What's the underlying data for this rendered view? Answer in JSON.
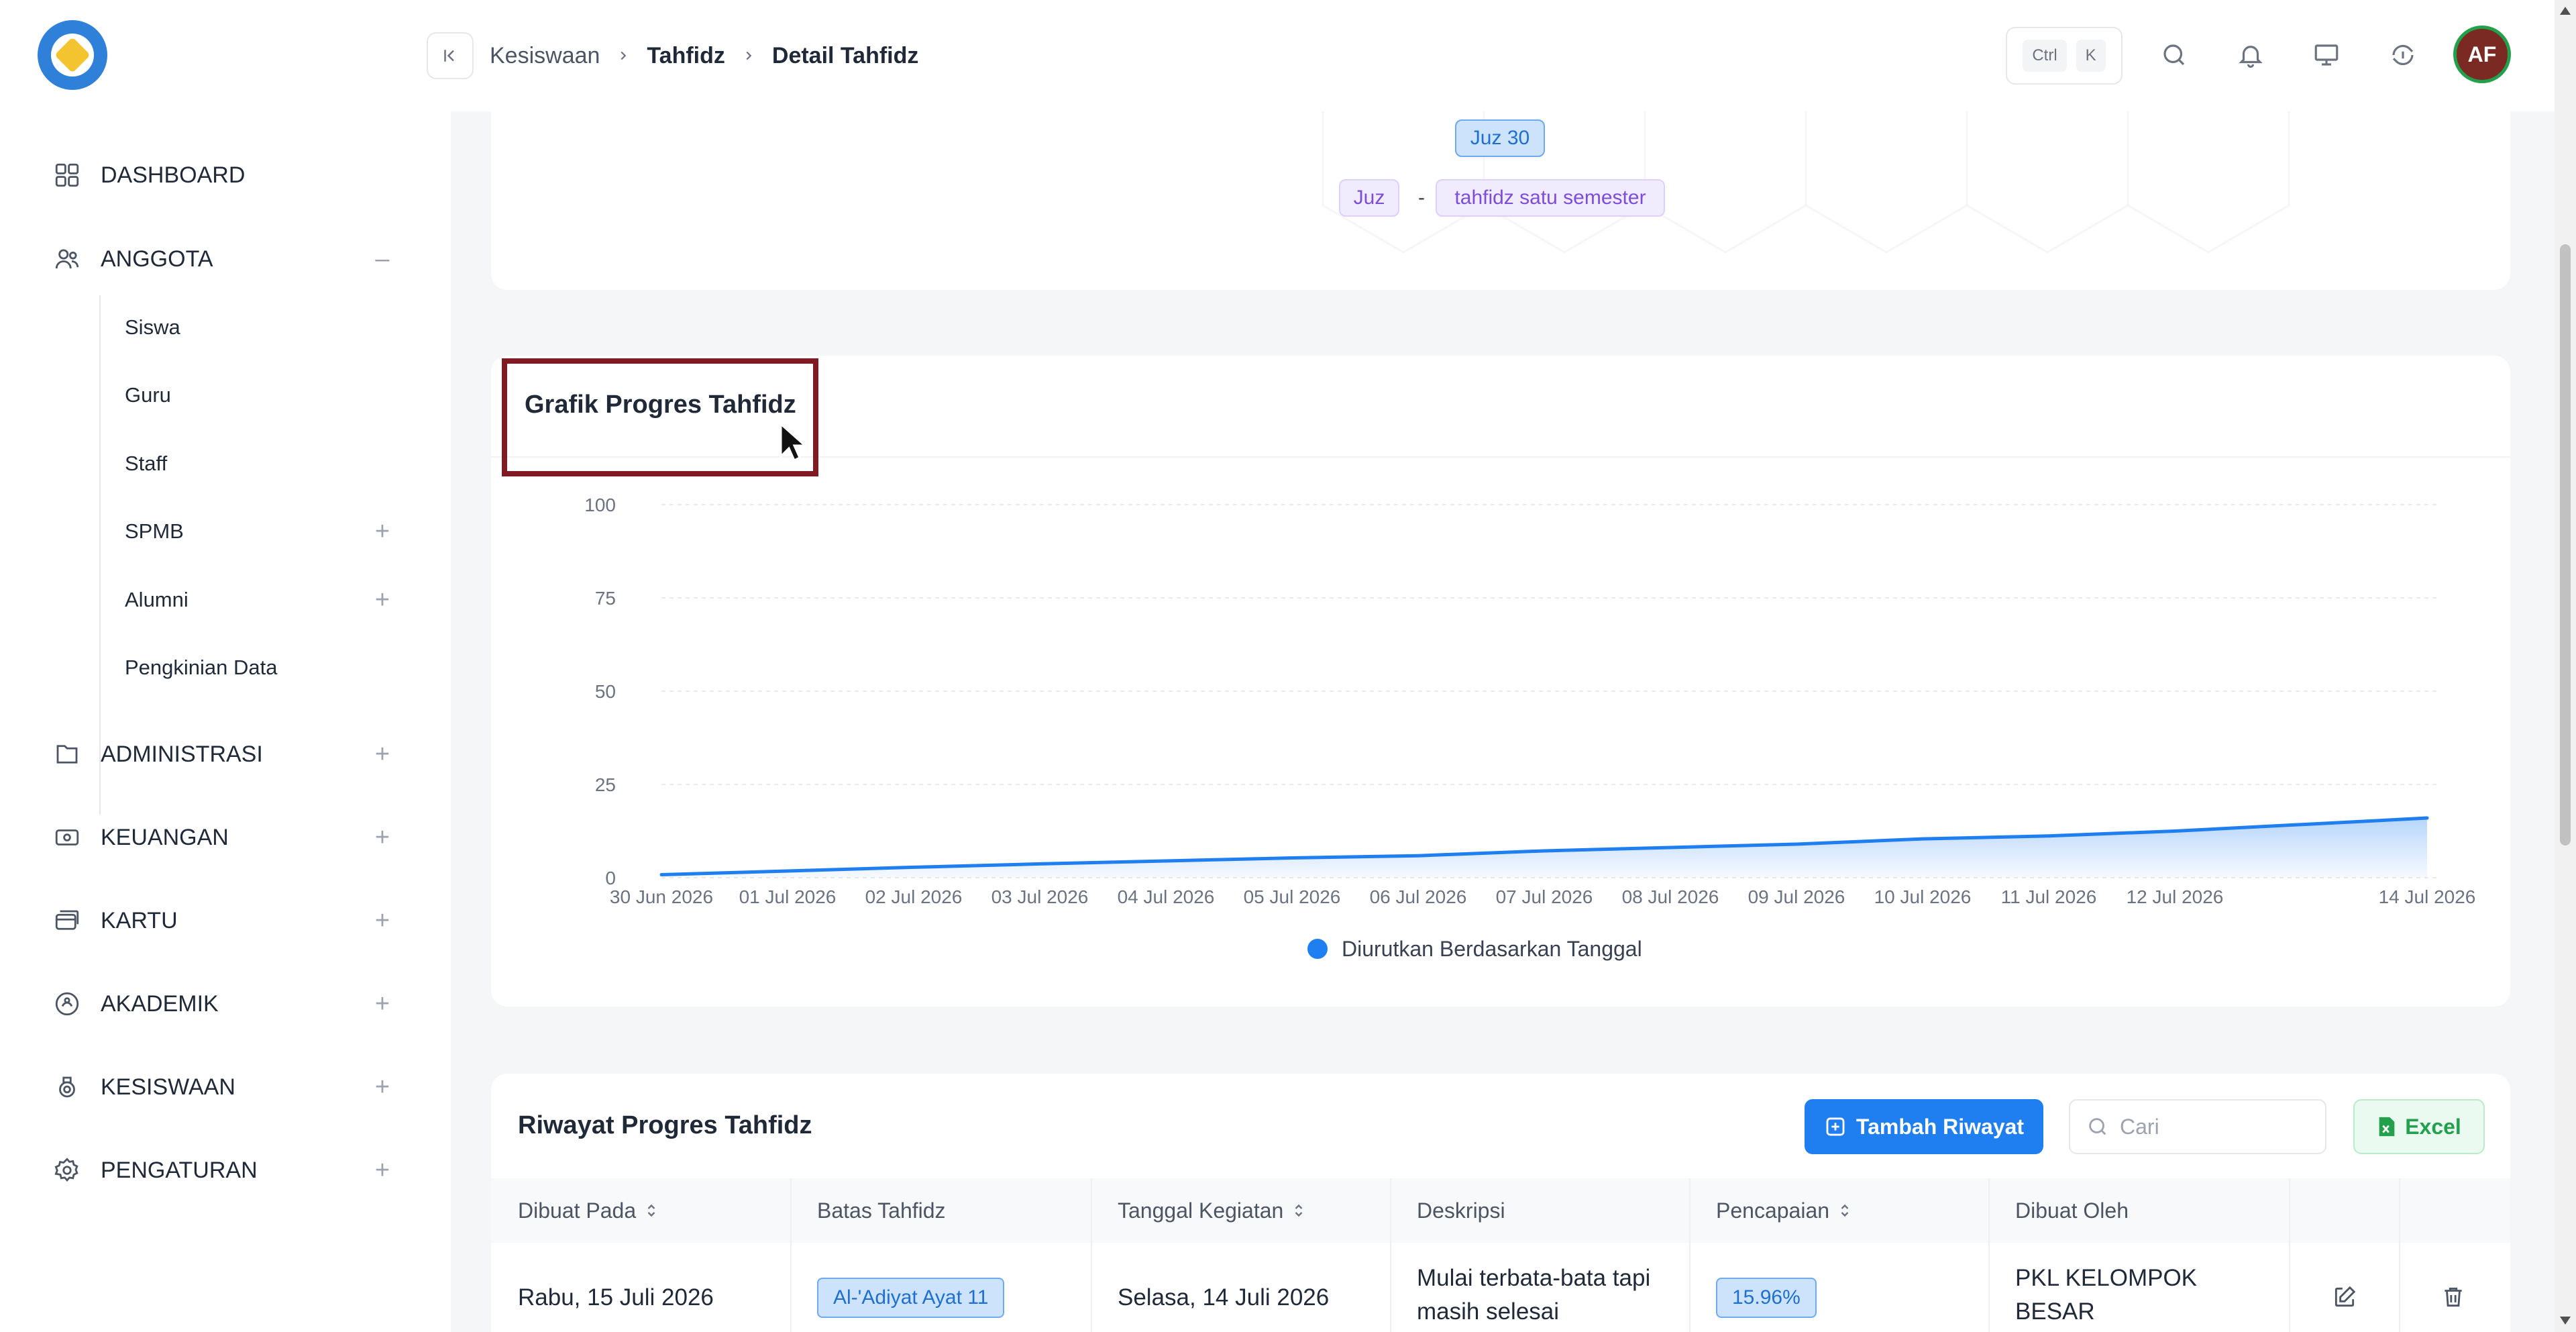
{
  "header": {
    "breadcrumb": [
      "Kesiswaan",
      "Tahfidz",
      "Detail Tahfidz"
    ],
    "kbd": [
      "Ctrl",
      "K"
    ],
    "avatar_initials": "AF",
    "colors": {
      "avatar_bg": "#7a2a22",
      "avatar_ring": "#22a04b"
    }
  },
  "sidebar": {
    "items": [
      {
        "label": "DASHBOARD",
        "icon": "grid-icon",
        "toggle": ""
      },
      {
        "label": "ANGGOTA",
        "icon": "users-icon",
        "toggle": "–"
      },
      {
        "label": "ADMINISTRASI",
        "icon": "folder-icon",
        "toggle": "+"
      },
      {
        "label": "KEUANGAN",
        "icon": "money-icon",
        "toggle": "+"
      },
      {
        "label": "KARTU",
        "icon": "card-icon",
        "toggle": "+"
      },
      {
        "label": "AKADEMIK",
        "icon": "academic-icon",
        "toggle": "+"
      },
      {
        "label": "KESISWAAN",
        "icon": "student-icon",
        "toggle": "+"
      },
      {
        "label": "PENGATURAN",
        "icon": "gear-icon",
        "toggle": "+"
      }
    ],
    "anggota_sub": [
      {
        "label": "Siswa",
        "toggle": ""
      },
      {
        "label": "Guru",
        "toggle": ""
      },
      {
        "label": "Staff",
        "toggle": ""
      },
      {
        "label": "SPMB",
        "toggle": "+"
      },
      {
        "label": "Alumni",
        "toggle": "+"
      },
      {
        "label": "Pengkinian Data",
        "toggle": ""
      }
    ]
  },
  "summary": {
    "juz_badge": "Juz 30",
    "tags": [
      "Juz",
      "-",
      "tahfidz satu semester"
    ]
  },
  "chart_card": {
    "title": "Grafik Progres Tahfidz"
  },
  "chart_data": {
    "type": "area",
    "title": "Grafik Progres Tahfidz",
    "x": [
      "30 Jun 2026",
      "01 Jul 2026",
      "02 Jul 2026",
      "03 Jul 2026",
      "04 Jul 2026",
      "05 Jul 2026",
      "06 Jul 2026",
      "07 Jul 2026",
      "08 Jul 2026",
      "09 Jul 2026",
      "10 Jul 2026",
      "11 Jul 2026",
      "12 Jul 2026",
      "14 Jul 2026"
    ],
    "series": [
      {
        "name": "Diurutkan Berdasarkan Tanggal",
        "values": [
          0.8,
          1.8,
          2.8,
          3.7,
          4.5,
          5.3,
          5.9,
          7.2,
          8.1,
          9.0,
          10.4,
          11.2,
          12.5,
          16.0
        ],
        "color": "#1f7ef0"
      }
    ],
    "y_ticks": [
      100,
      75,
      50,
      25,
      0
    ],
    "ylim": [
      0,
      100
    ],
    "grid": true,
    "legend": "bottom-center"
  },
  "table_card": {
    "title": "Riwayat Progres Tahfidz",
    "add_label": "Tambah Riwayat",
    "search_placeholder": "Cari",
    "excel_label": "Excel",
    "columns": [
      "Dibuat Pada",
      "Batas Tahfidz",
      "Tanggal Kegiatan",
      "Deskripsi",
      "Pencapaian",
      "Dibuat Oleh"
    ],
    "rows": [
      {
        "dibuat_pada": "Rabu, 15 Juli 2026",
        "batas": "Al-'Adiyat Ayat 11",
        "tanggal": "Selasa, 14 Juli 2026",
        "deskripsi": [
          "Mulai terbata-bata tapi",
          "masih selesai"
        ],
        "pencapaian": "15.96%",
        "dibuat_oleh": [
          "PKL KELOMPOK",
          "BESAR"
        ]
      }
    ]
  }
}
